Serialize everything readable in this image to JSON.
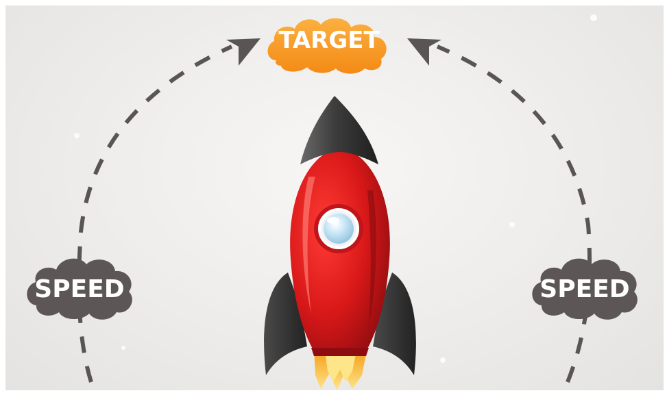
{
  "labels": {
    "target": "TARGET",
    "speed_left": "SPEED",
    "speed_right": "SPEED"
  },
  "colors": {
    "target_badge": "#f7941d",
    "target_badge_light": "#fbb040",
    "speed_badge": "#5d5656",
    "arrow_dash": "#5a5555",
    "rocket_body": "#e01b1b",
    "rocket_body_dark": "#9e0f12",
    "rocket_nose": "#3a3a3a",
    "rocket_fin": "#2f2f2f",
    "porthole_glass": "#bfe3f5",
    "flame_outer": "#f7b21a",
    "flame_inner": "#fde58a",
    "background": "#efeeec"
  },
  "icons": {
    "rocket": "rocket-icon",
    "arrow_left": "arrow-up-right-icon",
    "arrow_right": "arrow-up-left-icon"
  }
}
